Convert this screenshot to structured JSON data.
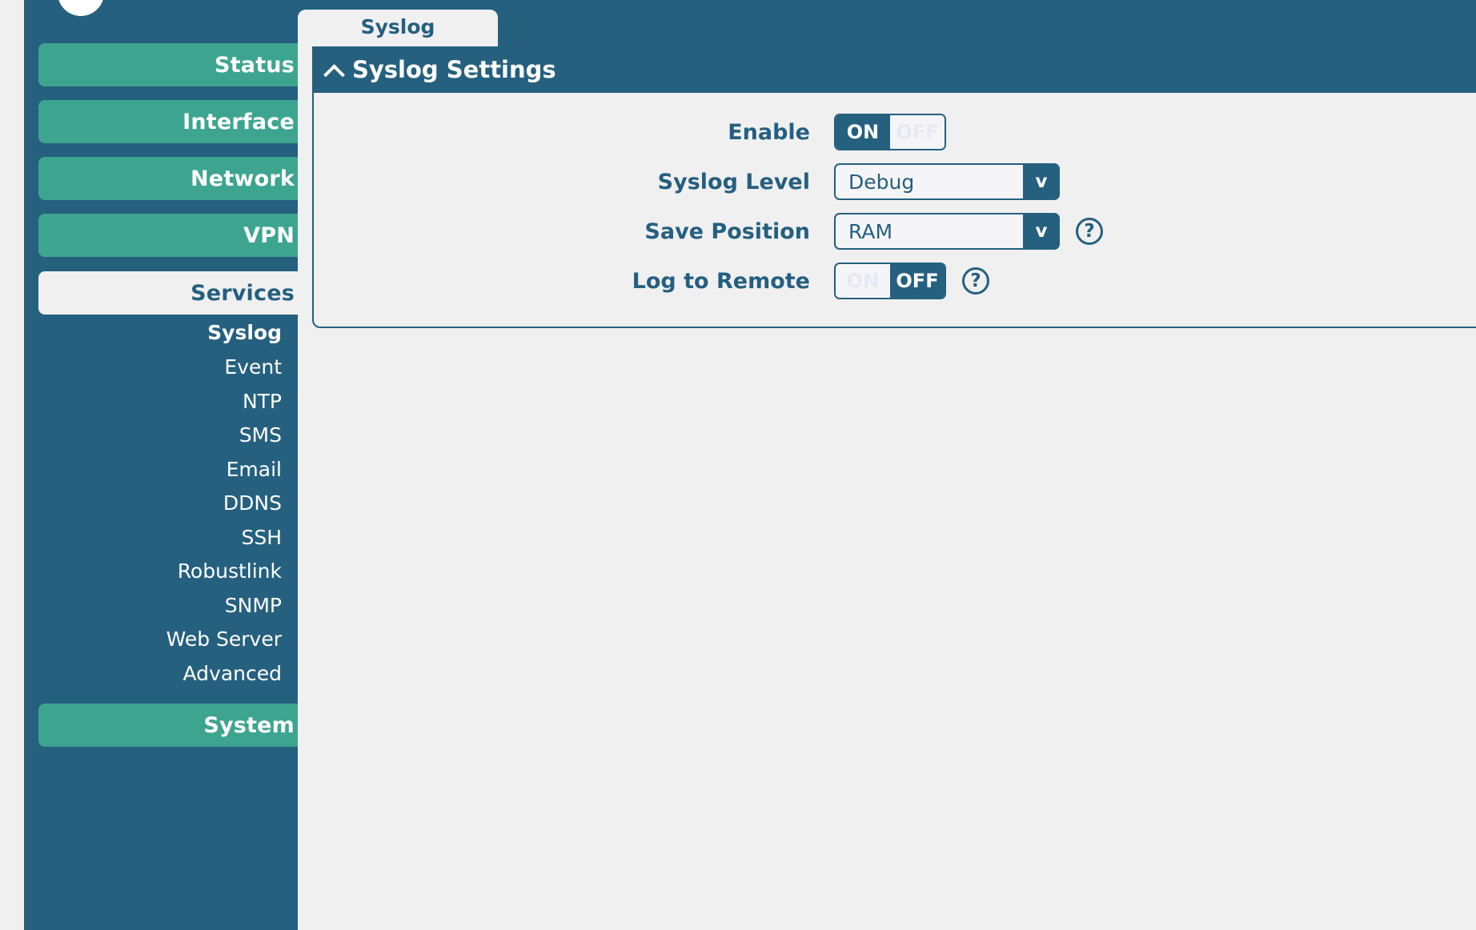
{
  "sidebar": {
    "logo": "logo-circle",
    "main_items": [
      {
        "label": "Status",
        "active": false
      },
      {
        "label": "Interface",
        "active": false
      },
      {
        "label": "Network",
        "active": false
      },
      {
        "label": "VPN",
        "active": false
      },
      {
        "label": "Services",
        "active": true
      }
    ],
    "sub_items": [
      {
        "label": "Syslog",
        "active": true
      },
      {
        "label": "Event",
        "active": false
      },
      {
        "label": "NTP",
        "active": false
      },
      {
        "label": "SMS",
        "active": false
      },
      {
        "label": "Email",
        "active": false
      },
      {
        "label": "DDNS",
        "active": false
      },
      {
        "label": "SSH",
        "active": false
      },
      {
        "label": "Robustlink",
        "active": false
      },
      {
        "label": "SNMP",
        "active": false
      },
      {
        "label": "Web Server",
        "active": false
      },
      {
        "label": "Advanced",
        "active": false
      }
    ],
    "footer_item": {
      "label": "System",
      "active": false
    }
  },
  "tabs": [
    {
      "label": "Syslog",
      "active": true
    }
  ],
  "panel": {
    "title": "Syslog Settings",
    "collapse_icon": "chevron-up-icon",
    "rows": [
      {
        "label": "Enable",
        "control": "toggle",
        "on_label": "ON",
        "off_label": "OFF",
        "value": "ON",
        "help": false
      },
      {
        "label": "Syslog Level",
        "control": "select",
        "value": "Debug",
        "arrow_glyph": "v",
        "help": false
      },
      {
        "label": "Save Position",
        "control": "select",
        "value": "RAM",
        "arrow_glyph": "v",
        "help": true,
        "help_glyph": "?"
      },
      {
        "label": "Log to Remote",
        "control": "toggle",
        "on_label": "ON",
        "off_label": "OFF",
        "value": "OFF",
        "help": true,
        "help_glyph": "?"
      }
    ]
  },
  "colors": {
    "brand_dark_blue": "#25607f",
    "brand_teal": "#3da58f",
    "page_bg": "#f0f0f0",
    "text_on_dark": "#ffffff",
    "label_blue": "#255f80",
    "inactive_toggle_text": "#e8e8f4"
  }
}
